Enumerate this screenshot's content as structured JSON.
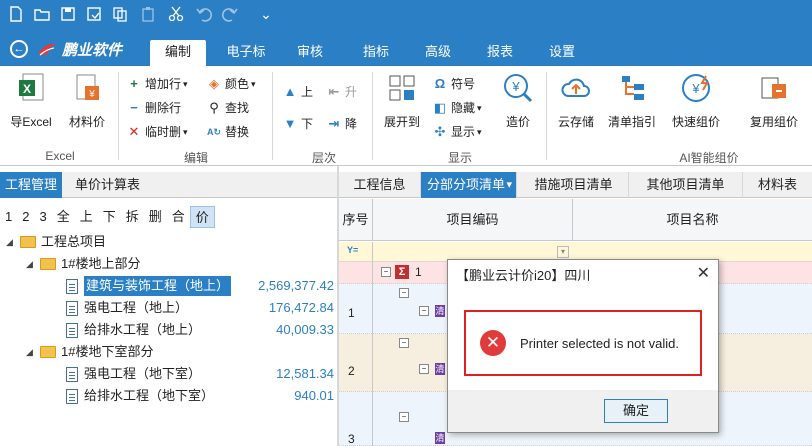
{
  "quick_access": {
    "icons": [
      "new-file-icon",
      "open-folder-icon",
      "save-icon",
      "save-as-icon",
      "copy-icon",
      "paste-icon",
      "cut-icon",
      "undo-icon",
      "redo-icon",
      "customize-icon"
    ],
    "customize_glyph": "⌄"
  },
  "app": {
    "name": "鹏业软件"
  },
  "menu": {
    "tabs": [
      "编制",
      "电子标",
      "审核",
      "指标",
      "高级",
      "报表",
      "设置"
    ],
    "active_index": 0
  },
  "ribbon": {
    "import_excel": "导Excel",
    "material_price": "材料价",
    "group_excel": "Excel",
    "add_row": "增加行",
    "delete_row": "删除行",
    "temp_delete": "临时删",
    "color": "颜色",
    "find": "查找",
    "replace": "替换",
    "group_edit": "编辑",
    "up": "上",
    "down": "下",
    "raise": "升",
    "lower": "降",
    "group_level": "层次",
    "expand_to": "展开到",
    "symbol": "符号",
    "hide": "隐藏",
    "display": "显示",
    "build_price": "造价",
    "group_display": "显示",
    "cloud_storage": "云存储",
    "list_guide": "清单指引",
    "quick_price": "快速组价",
    "reuse_price": "复用组价",
    "group_ai": "AI智能组价"
  },
  "left_panel": {
    "tabs": [
      "工程管理",
      "单价计算表"
    ],
    "active_tab": 0,
    "tools": [
      "1",
      "2",
      "3",
      "全",
      "上",
      "下",
      "拆",
      "删",
      "合",
      "价"
    ],
    "active_tool": 9,
    "tree": [
      {
        "label": "工程总项目",
        "level": 0,
        "type": "folder",
        "value": ""
      },
      {
        "label": "1#楼地上部分",
        "level": 1,
        "type": "folder",
        "value": ""
      },
      {
        "label": "建筑与装饰工程（地上）",
        "level": 2,
        "type": "doc",
        "value": "2,569,377.42",
        "selected": true
      },
      {
        "label": "强电工程（地上）",
        "level": 2,
        "type": "doc",
        "value": "176,472.84"
      },
      {
        "label": "给排水工程（地上）",
        "level": 2,
        "type": "doc",
        "value": "40,009.33"
      },
      {
        "label": "1#楼地下室部分",
        "level": 1,
        "type": "folder",
        "value": ""
      },
      {
        "label": "强电工程（地下室）",
        "level": 2,
        "type": "doc",
        "value": "12,581.34"
      },
      {
        "label": "给排水工程（地下室）",
        "level": 2,
        "type": "doc",
        "value": "940.01"
      }
    ]
  },
  "right_panel": {
    "tabs": [
      "工程信息",
      "分部分项清单",
      "措施项目清单",
      "其他项目清单",
      "材料表"
    ],
    "active_tab": 1,
    "tab_dropdown_glyph": "▾",
    "columns": [
      "序号",
      "项目编码",
      "项目名称"
    ],
    "filter_glyph": "Y=",
    "rows": [
      {
        "num": "",
        "code": "1"
      },
      {
        "num": "1",
        "code": ""
      },
      {
        "num": "2",
        "code": ""
      },
      {
        "num": "3",
        "code": ""
      }
    ],
    "purple_tag": "清"
  },
  "dialog": {
    "title": "【鹏业云计价i20】四川",
    "close_glyph": "✕",
    "error_glyph": "✕",
    "message": "Printer selected is not valid.",
    "ok_label": "确定"
  },
  "colors": {
    "brand_blue": "#2b7fc4",
    "error_red": "#e02020",
    "link_value": "#2b7fc4"
  }
}
